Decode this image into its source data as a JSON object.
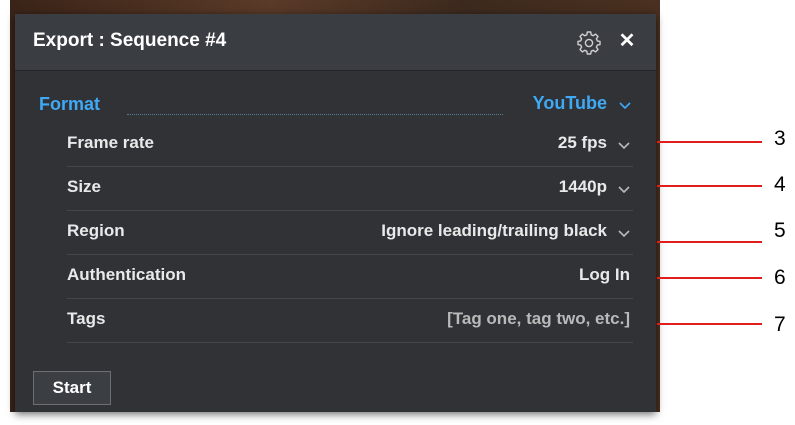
{
  "dialog": {
    "title": "Export : Sequence #4",
    "icons": {
      "settings": "gear-icon",
      "close": "close-icon",
      "dropdown": "chevron-down-icon"
    },
    "close_glyph": "✕"
  },
  "format": {
    "label": "Format",
    "value": "YouTube"
  },
  "settings": [
    {
      "label": "Frame rate",
      "value": "25 fps",
      "has_dropdown": true
    },
    {
      "label": "Size",
      "value": "1440p",
      "has_dropdown": true
    },
    {
      "label": "Region",
      "value": "Ignore leading/trailing black",
      "has_dropdown": true
    },
    {
      "label": "Authentication",
      "value": "Log In",
      "has_dropdown": false
    },
    {
      "label": "Tags",
      "placeholder": "[Tag one, tag two, etc.]",
      "has_dropdown": false
    }
  ],
  "start_button": {
    "label": "Start"
  },
  "callouts": [
    "3",
    "4",
    "5",
    "6",
    "7"
  ],
  "colors": {
    "accent": "#3fa9f5",
    "panel": "#303236",
    "titlebar": "#3a3d42",
    "callout_line": "#e01e1e"
  }
}
